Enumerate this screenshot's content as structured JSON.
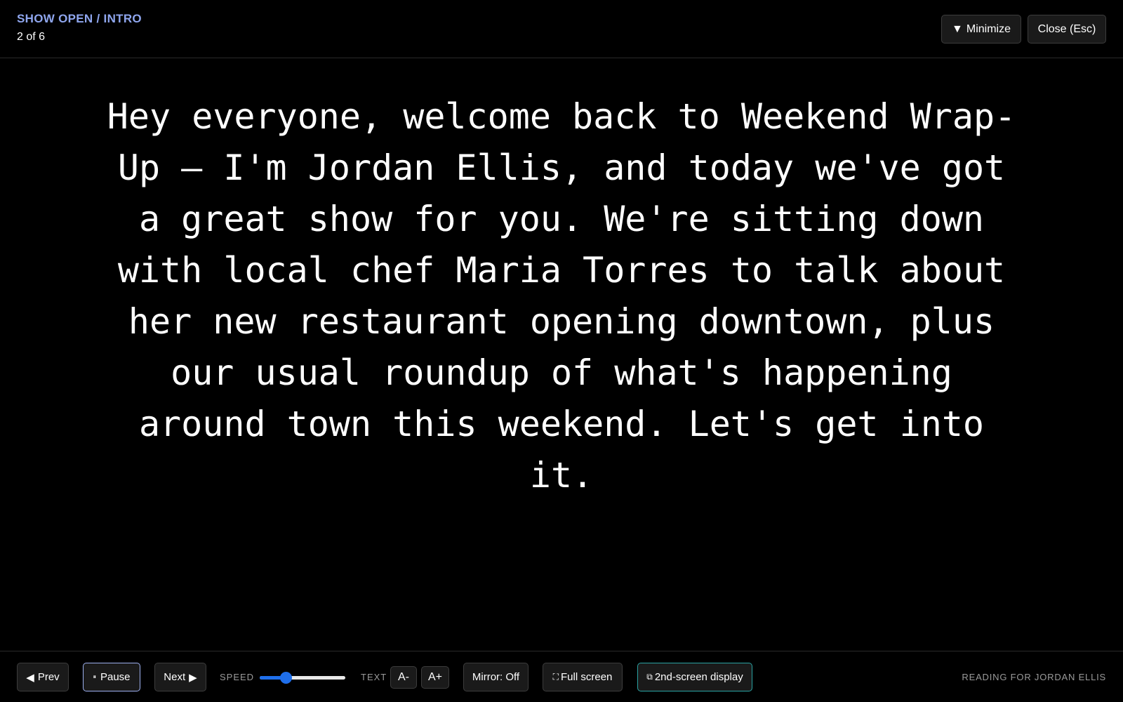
{
  "header": {
    "segment_title": "SHOW OPEN / INTRO",
    "segment_count": "2 of 6",
    "minimize_icon": "▼",
    "minimize_label": "Minimize",
    "close_label": "Close (Esc)"
  },
  "script": {
    "text": "Hey everyone, welcome back to Weekend Wrap-Up — I'm Jordan Ellis, and today we've got a great show for you. We're sitting down with local chef Maria Torres to talk about her new restaurant opening downtown, plus our usual roundup of what's happening around town this weekend. Let's get into it."
  },
  "controls": {
    "prev_icon": "◀",
    "prev_label": "Prev",
    "pause_icon": "⏸",
    "pause_label": "Pause",
    "next_label": "Next",
    "next_icon": "▶",
    "speed_label": "SPEED",
    "speed_value": 0.3,
    "text_label": "TEXT",
    "text_smaller": "A-",
    "text_larger": "A+",
    "mirror_label": "Mirror: Off",
    "fullscreen_icon": "⛶",
    "fullscreen_label": "Full screen",
    "second_screen_icon": "⧉",
    "second_screen_label": "2nd-screen display",
    "reading_for": "READING FOR JORDAN ELLIS"
  },
  "colors": {
    "background": "#000000",
    "segment_title": "#8fa6ee",
    "slider_accent": "#1f6feb",
    "pause_border": "#9db0f0",
    "second_screen_border": "#2aa3a3"
  }
}
